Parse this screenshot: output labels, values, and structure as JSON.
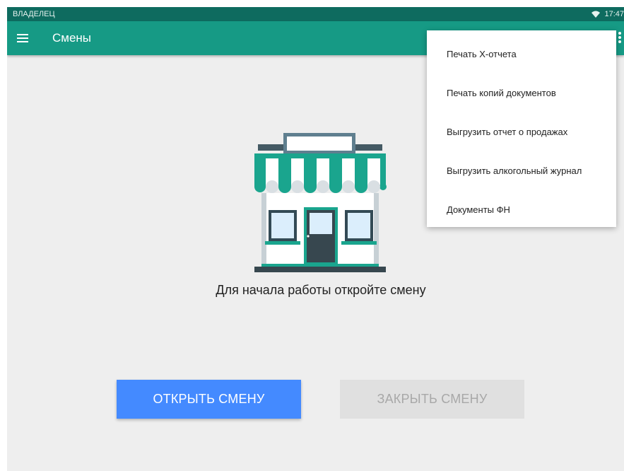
{
  "status_bar": {
    "owner_label": "ВЛАДЕЛЕЦ",
    "time": "17:47",
    "wifi_icon": "wifi-icon"
  },
  "app_bar": {
    "title": "Смены",
    "menu_icon": "menu-icon",
    "overflow_icon": "more-vert-icon"
  },
  "menu": {
    "items": [
      {
        "label": "Печать Х-отчета"
      },
      {
        "label": "Печать копий документов"
      },
      {
        "label": "Выгрузить отчет о продажах"
      },
      {
        "label": "Выгрузить алкогольный журнал"
      },
      {
        "label": "Документы ФН"
      }
    ]
  },
  "main": {
    "illustration": "shop-icon",
    "message": "Для начала работы откройте смену",
    "open_button": "ОТКРЫТЬ СМЕНУ",
    "close_button": "ЗАКРЫТЬ СМЕНУ"
  },
  "colors": {
    "app_bar": "#169a85",
    "status_bar": "#0e6b5f",
    "primary_button": "#448aff",
    "disabled_button": "#e0e0e0"
  }
}
